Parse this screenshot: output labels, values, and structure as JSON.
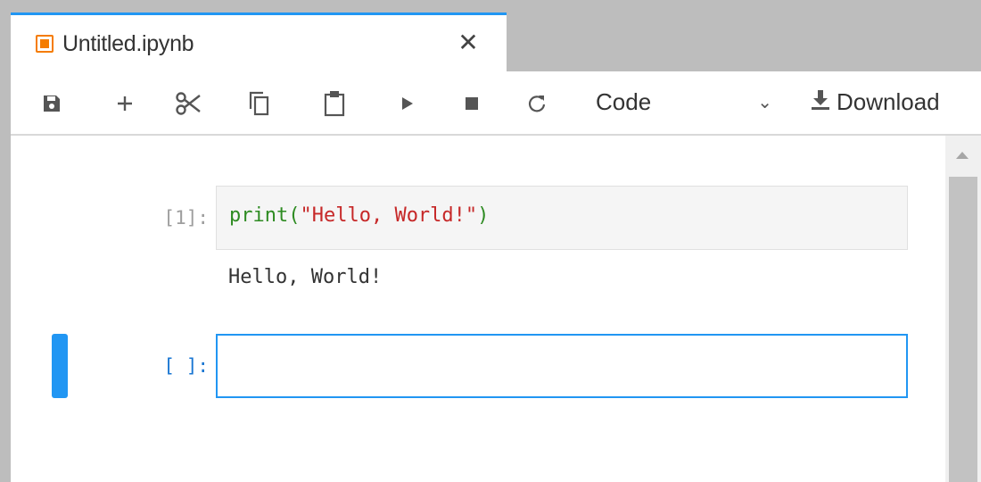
{
  "tab": {
    "title": "Untitled.ipynb",
    "icon": "notebook-icon",
    "close_glyph": "✕"
  },
  "toolbar": {
    "icons": [
      "save-icon",
      "add-icon",
      "cut-icon",
      "copy-icon",
      "paste-icon",
      "run-icon",
      "stop-icon",
      "restart-icon"
    ],
    "cell_type": "Code",
    "cell_type_arrow": "⌄",
    "download_label": "Download"
  },
  "cells": [
    {
      "prompt": "[1]:",
      "code": {
        "fn": "print",
        "open": "(",
        "str": "\"Hello, World!\"",
        "close": ")"
      },
      "output": "Hello, World!"
    },
    {
      "prompt": "[ ]:",
      "code": ""
    }
  ],
  "colors": {
    "accent": "#2196f3",
    "tab_icon": "#f57c00",
    "code_fn": "#2e8b22",
    "code_str": "#c62828"
  }
}
